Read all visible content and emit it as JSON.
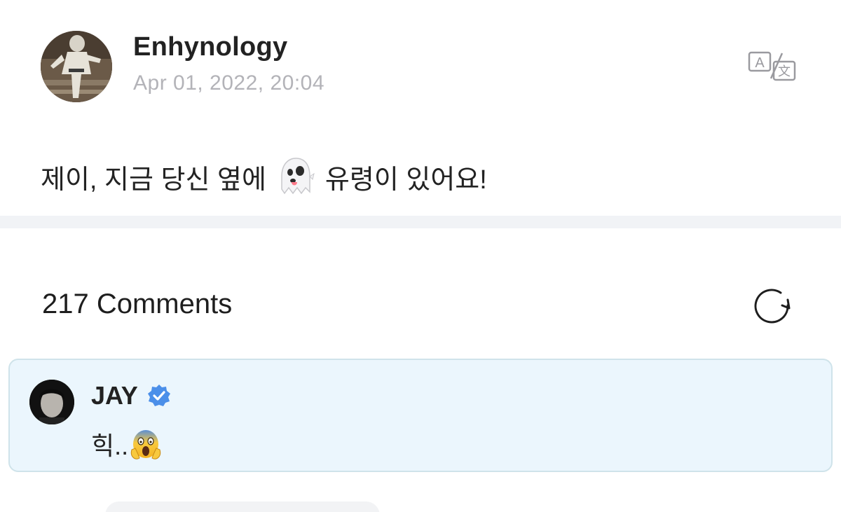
{
  "post": {
    "author": "Enhynology",
    "date": "Apr 01, 2022, 20:04",
    "text_before": "제이, 지금 당신 옆에",
    "text_after": "유령이 있어요!",
    "emoji_icon": "ghost-emoji"
  },
  "comments": {
    "header": "217 Comments",
    "items": [
      {
        "author": "JAY",
        "verified": true,
        "text": "힉..",
        "emoji_icon": "face-screaming-in-fear-emoji",
        "highlight_color": "#ebf6fd"
      }
    ]
  },
  "icons": {
    "translate": "translate-icon",
    "refresh": "refresh-icon",
    "verified": "verified-badge-icon"
  },
  "colors": {
    "verified_blue": "#4b8fe9",
    "date_gray": "#b3b3b8",
    "divider": "#f1f3f6"
  }
}
